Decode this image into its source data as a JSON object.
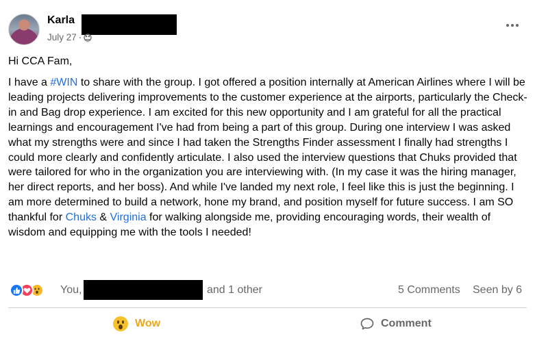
{
  "post": {
    "author": "Karla",
    "date": "July 27",
    "separator": "·",
    "greeting": "Hi CCA Fam,",
    "body": {
      "p1": "I have a ",
      "hashtag": "#WIN",
      "p2": " to share with the group. I got offered a position internally at American Airlines where I will be leading projects delivering improvements to the customer experience at the airports, particularly the Check-in and Bag drop experience. I am excited for this new opportunity and I am grateful for all the practical learnings and encouragement I've had from being a part of this group.  During one interview I was asked what my strengths were and since I had taken the Strengths Finder assessment I finally had strengths I could more clearly and confidently articulate. I also used the interview questions that Chuks provided that were tailored for who in the organization you are interviewing with. (In my case it was the hiring manager, her direct reports, and her boss). And while I've landed my next role, I feel like this is just the beginning. I am more determined to build a network, hone my brand, and position myself for future success. I am SO thankful for ",
      "mention1": "Chuks",
      "amp": " & ",
      "mention2": "Virginia",
      "p3": " for walking alongside me, providing encouraging words, their wealth of wisdom and equipping me with the tools I needed!"
    }
  },
  "reactions": {
    "you": "You,",
    "others": "and 1 other",
    "comments": "5 Comments",
    "seen": "Seen by 6"
  },
  "actions": {
    "wow_label": "Wow",
    "comment_label": "Comment"
  },
  "colors": {
    "link": "#216fdb",
    "wow": "#e8a91c",
    "secondary_text": "#65676b"
  }
}
